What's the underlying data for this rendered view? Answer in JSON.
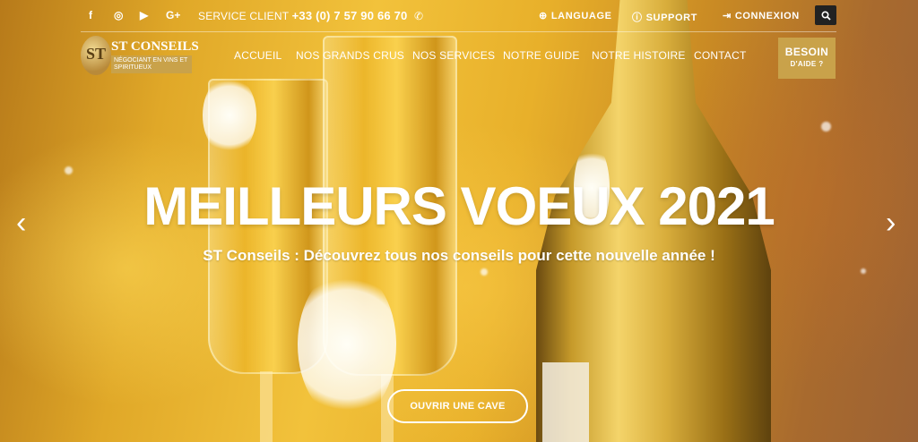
{
  "topbar": {
    "social": [
      {
        "name": "facebook-icon",
        "glyph": "f"
      },
      {
        "name": "instagram-icon",
        "glyph": "◎"
      },
      {
        "name": "youtube-icon",
        "glyph": "▶"
      },
      {
        "name": "google-plus-icon",
        "glyph": "G+"
      }
    ],
    "service_label": "SERVICE CLIENT",
    "service_phone": "+33 (0) 7 57 90 66 70",
    "language_label": "LANGUAGE",
    "support_label": "SUPPORT",
    "login_label": "CONNEXION"
  },
  "logo": {
    "mark": "ST",
    "name": "ST CONSEILS",
    "tagline": "NÉGOCIANT EN VINS ET SPIRITUEUX"
  },
  "nav": {
    "items": [
      "ACCUEIL",
      "NOS GRANDS CRUS",
      "NOS SERVICES",
      "NOTRE GUIDE",
      "NOTRE HISTOIRE",
      "CONTACT"
    ]
  },
  "help": {
    "line1": "BESOIN",
    "line2": "D'AIDE ?"
  },
  "hero": {
    "headline": "MEILLEURS VOEUX 2021",
    "subline": "ST Conseils : Découvrez tous nos conseils pour cette nouvelle année !",
    "cta_label": "OUVRIR UNE CAVE",
    "prev_glyph": "‹",
    "next_glyph": "›"
  },
  "colors": {
    "accent_gold": "#c9a24a",
    "search_bg": "#222222"
  }
}
